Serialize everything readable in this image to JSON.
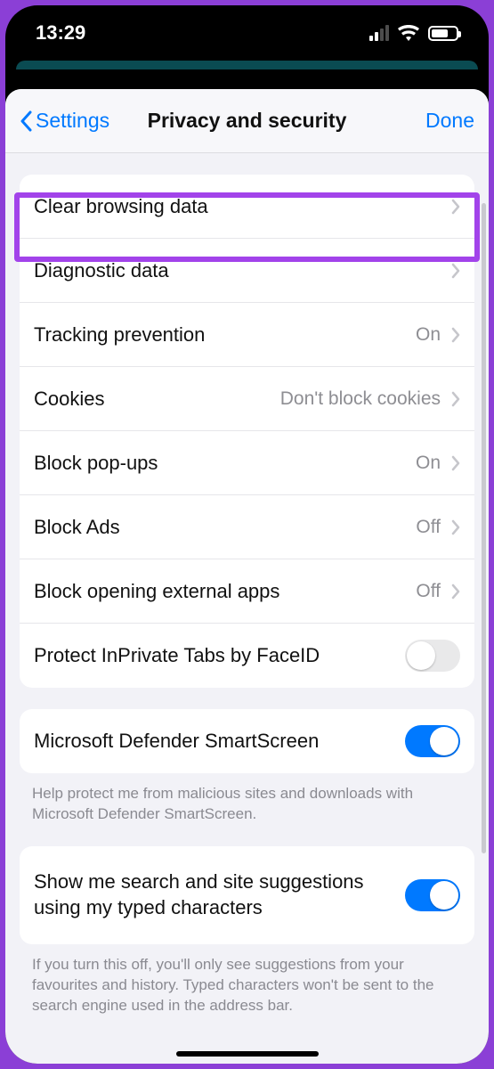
{
  "status": {
    "time": "13:29"
  },
  "nav": {
    "back": "Settings",
    "title": "Privacy and security",
    "done": "Done"
  },
  "section1": {
    "rows": [
      {
        "label": "Clear browsing data",
        "value": "",
        "chevron": true,
        "highlighted": true
      },
      {
        "label": "Diagnostic data",
        "value": "",
        "chevron": true
      },
      {
        "label": "Tracking prevention",
        "value": "On",
        "chevron": true
      },
      {
        "label": "Cookies",
        "value": "Don't block cookies",
        "chevron": true
      },
      {
        "label": "Block pop-ups",
        "value": "On",
        "chevron": true
      },
      {
        "label": "Block Ads",
        "value": "Off",
        "chevron": true
      },
      {
        "label": "Block opening external apps",
        "value": "Off",
        "chevron": true
      },
      {
        "label": "Protect InPrivate Tabs by FaceID",
        "toggle": false
      }
    ]
  },
  "section2": {
    "row": {
      "label": "Microsoft Defender SmartScreen",
      "toggle": true
    },
    "footer": "Help protect me from malicious sites and downloads with Microsoft Defender SmartScreen."
  },
  "section3": {
    "row": {
      "label": "Show me search and site suggestions using my typed characters",
      "toggle": true
    },
    "footer": "If you turn this off, you'll only see suggestions from your favourites and history. Typed characters won't be sent to the search engine used in the address bar."
  }
}
